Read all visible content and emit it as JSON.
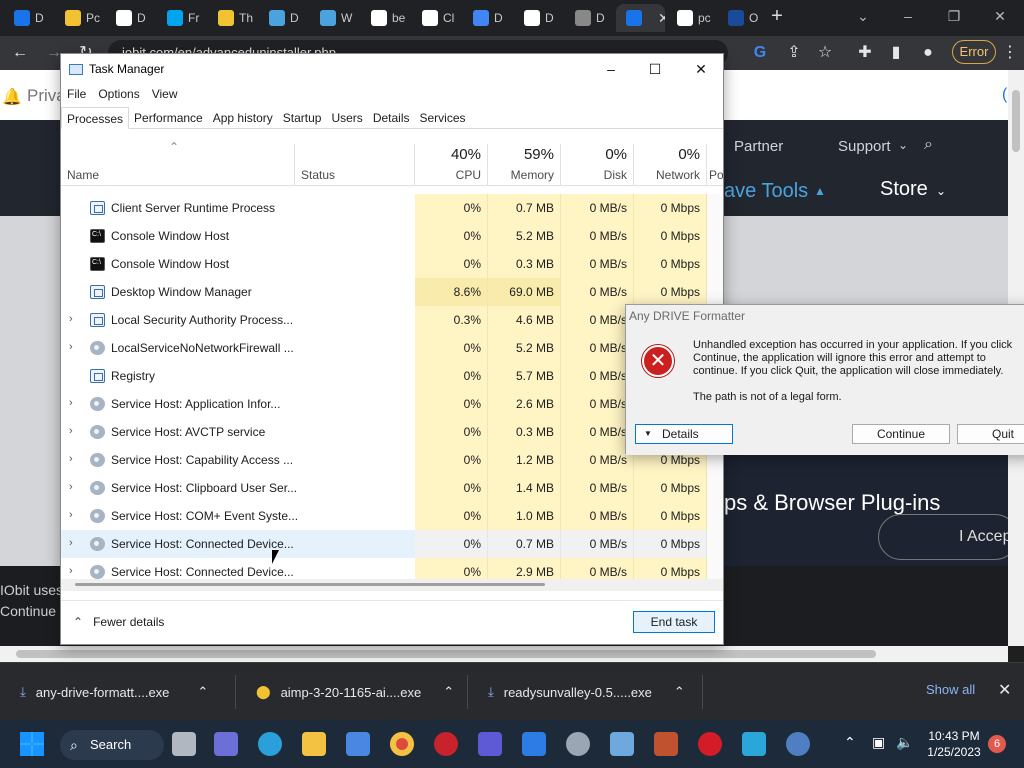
{
  "browser": {
    "tabs": [
      {
        "label": "D",
        "fav": "#1a73e8"
      },
      {
        "label": "Pc",
        "fav": "#f1c232"
      },
      {
        "label": "D",
        "fav": "#ffffff"
      },
      {
        "label": "Fr",
        "fav": "#00a4ef"
      },
      {
        "label": "Th",
        "fav": "#f1c232"
      },
      {
        "label": "D",
        "fav": "#4aa3df"
      },
      {
        "label": "W",
        "fav": "#4aa3df"
      },
      {
        "label": "be",
        "fav": "#ffffff"
      },
      {
        "label": "Cl",
        "fav": "#ffffff"
      },
      {
        "label": "D",
        "fav": "#4285f4"
      },
      {
        "label": "D",
        "fav": "#ffffff"
      },
      {
        "label": "D",
        "fav": "#888888"
      },
      {
        "label": "",
        "fav": "#1a73e8",
        "active": true
      },
      {
        "label": "pc",
        "fav": "#ffffff"
      },
      {
        "label": "O",
        "fav": "#1a4a9a",
        "badge": "ov"
      }
    ],
    "address": "iobit.com/en/advanceduninstaller.php",
    "error_label": "Error"
  },
  "webpage": {
    "notice": "Priva",
    "nav": {
      "partner": "Partner",
      "support": "Support",
      "free_tools": "ave Tools",
      "store": "Store"
    },
    "hero": {
      "tagline": "ps & Browser Plug-ins"
    },
    "cookie": {
      "line1": "IObit uses",
      "line2": "Continue",
      "accept": "I Accep"
    },
    "right_edge": "("
  },
  "task_manager": {
    "title": "Task Manager",
    "menu": [
      "File",
      "Options",
      "View"
    ],
    "tabs": [
      "Processes",
      "Performance",
      "App history",
      "Startup",
      "Users",
      "Details",
      "Services"
    ],
    "active_tab": "Processes",
    "columns": {
      "name": "Name",
      "status": "Status",
      "cpu": {
        "pct": "40%",
        "label": "CPU"
      },
      "memory": {
        "pct": "59%",
        "label": "Memory"
      },
      "disk": {
        "pct": "0%",
        "label": "Disk"
      },
      "network": {
        "pct": "0%",
        "label": "Network"
      },
      "power": "Po"
    },
    "processes": [
      {
        "name": "Client Server Runtime Process",
        "icon": "window-icon",
        "expand": false,
        "cpu": "0%",
        "memory": "0.7 MB",
        "disk": "0 MB/s",
        "network": "0 Mbps"
      },
      {
        "name": "Console Window Host",
        "icon": "console-icon",
        "expand": false,
        "cpu": "0%",
        "memory": "5.2 MB",
        "disk": "0 MB/s",
        "network": "0 Mbps"
      },
      {
        "name": "Console Window Host",
        "icon": "console-icon",
        "expand": false,
        "cpu": "0%",
        "memory": "0.3 MB",
        "disk": "0 MB/s",
        "network": "0 Mbps"
      },
      {
        "name": "Desktop Window Manager",
        "icon": "window-icon",
        "expand": false,
        "cpu": "8.6%",
        "memory": "69.0 MB",
        "disk": "0 MB/s",
        "network": "0 Mbps",
        "warm": true
      },
      {
        "name": "Local Security Authority Process...",
        "icon": "window-icon",
        "expand": true,
        "cpu": "0.3%",
        "memory": "4.6 MB",
        "disk": "0 MB/s",
        "network": "0 Mbps"
      },
      {
        "name": "LocalServiceNoNetworkFirewall ...",
        "icon": "gear-icon",
        "expand": true,
        "cpu": "0%",
        "memory": "5.2 MB",
        "disk": "0 MB/s",
        "network": "0 Mbps"
      },
      {
        "name": "Registry",
        "icon": "window-icon",
        "expand": false,
        "cpu": "0%",
        "memory": "5.7 MB",
        "disk": "0 MB/s",
        "network": "0 Mbps"
      },
      {
        "name": "Service Host: Application Infor...",
        "icon": "gear-icon",
        "expand": true,
        "cpu": "0%",
        "memory": "2.6 MB",
        "disk": "0 MB/s",
        "network": "0 Mbps"
      },
      {
        "name": "Service Host: AVCTP service",
        "icon": "gear-icon",
        "expand": true,
        "cpu": "0%",
        "memory": "0.3 MB",
        "disk": "0 MB/s",
        "network": "0 Mbps"
      },
      {
        "name": "Service Host: Capability Access ...",
        "icon": "gear-icon",
        "expand": true,
        "cpu": "0%",
        "memory": "1.2 MB",
        "disk": "0 MB/s",
        "network": "0 Mbps"
      },
      {
        "name": "Service Host: Clipboard User Ser...",
        "icon": "gear-icon",
        "expand": true,
        "cpu": "0%",
        "memory": "1.4 MB",
        "disk": "0 MB/s",
        "network": "0 Mbps"
      },
      {
        "name": "Service Host: COM+ Event Syste...",
        "icon": "gear-icon",
        "expand": true,
        "cpu": "0%",
        "memory": "1.0 MB",
        "disk": "0 MB/s",
        "network": "0 Mbps"
      },
      {
        "name": "Service Host: Connected Device...",
        "icon": "gear-icon",
        "expand": true,
        "cpu": "0%",
        "memory": "0.7 MB",
        "disk": "0 MB/s",
        "network": "0 Mbps",
        "highlight": true
      },
      {
        "name": "Service Host: Connected Device...",
        "icon": "gear-icon",
        "expand": true,
        "cpu": "0%",
        "memory": "2.9 MB",
        "disk": "0 MB/s",
        "network": "0 Mbps"
      }
    ],
    "fewer_details": "Fewer details",
    "end_task": "End task"
  },
  "error_dialog": {
    "title": "Any DRIVE Formatter",
    "message": "Unhandled exception has occurred in your application. If you click Continue, the application will ignore this error and attempt to continue. If you click Quit, the application will close immediately.",
    "detail": "The path is not of a legal form.",
    "details_button": "Details",
    "continue_button": "Continue",
    "quit_button": "Quit"
  },
  "downloads": {
    "items": [
      "any-drive-formatt....exe",
      "aimp-3-20-1165-ai....exe",
      "readysunvalley-0.5.....exe"
    ],
    "show_all": "Show all"
  },
  "taskbar": {
    "search": "Search",
    "time": "10:43 PM",
    "date": "1/25/2023",
    "notifications": "6"
  }
}
